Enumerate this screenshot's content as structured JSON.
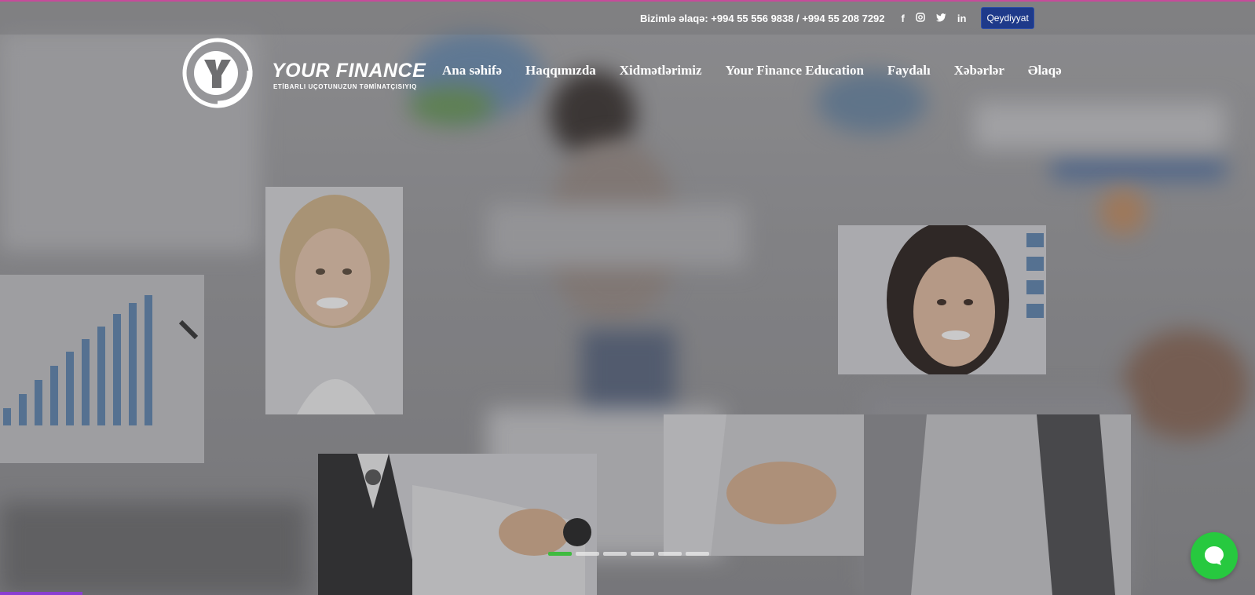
{
  "contact": {
    "text": "Bizimlə əlaqə: +994 55 556 9838 / +994 55 208 7292",
    "social_icons": [
      "facebook-icon",
      "instagram-icon",
      "twitter-icon",
      "linkedin-icon"
    ],
    "register_label": "Qeydiyyat"
  },
  "logo": {
    "title": "YOUR FINANCE",
    "subtitle": "ETİBARLI UÇOTUNUZUN TƏMİNATÇISIYIQ"
  },
  "nav": {
    "items": [
      "Ana səhifə",
      "Haqqımızda",
      "Xidmətlərimiz",
      "Your Finance Education",
      "Faydalı",
      "Xəbərlər",
      "Əlaqə"
    ]
  },
  "slider": {
    "active_index": 0,
    "dot_count": 6
  },
  "colors": {
    "accent_top": "#c64b9b",
    "register_bg": "#1e3a8a",
    "active_dot": "#3fbb3f",
    "chat_bg": "#27c93f",
    "progress": "#8a3fd1"
  }
}
